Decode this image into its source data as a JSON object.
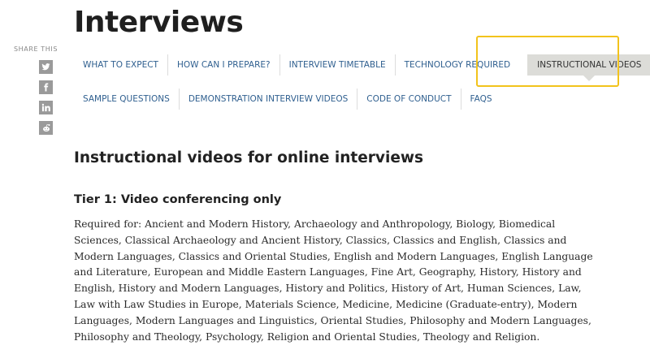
{
  "page": {
    "title": "Interviews"
  },
  "share": {
    "label": "SHARE THIS",
    "buttons": [
      {
        "icon": "twitter-icon"
      },
      {
        "icon": "facebook-icon"
      },
      {
        "icon": "linkedin-icon"
      },
      {
        "icon": "reddit-icon"
      }
    ]
  },
  "nav": {
    "row1": [
      "WHAT TO EXPECT",
      "HOW CAN I PREPARE?",
      "INTERVIEW TIMETABLE",
      "TECHNOLOGY REQUIRED",
      "INSTRUCTIONAL VIDEOS"
    ],
    "row2": [
      "SAMPLE QUESTIONS",
      "DEMONSTRATION INTERVIEW VIDEOS",
      "CODE OF CONDUCT",
      "FAQS"
    ],
    "active": "INSTRUCTIONAL VIDEOS"
  },
  "content": {
    "heading": "Instructional videos for online interviews",
    "tier1_heading": "Tier 1: Video conferencing only",
    "tier1_text": "Required for: Ancient and Modern History, Archaeology and Anthropology, Biology, Biomedical Sciences, Classical Archaeology and Ancient History, Classics, Classics and English, Classics and Modern Languages, Classics and Oriental Studies, English and Modern Languages, English Language and Literature, European and Middle Eastern Languages, Fine Art, Geography, History, History and English, History and Modern Languages, History and Politics, History of Art, Human Sciences, Law, Law with Law Studies in Europe, Materials Science, Medicine, Medicine (Graduate-entry), Modern Languages, Modern Languages and Linguistics, Oriental Studies, Philosophy and Modern Languages, Philosophy and Theology, Psychology, Religion and Oriental Studies, Theology and Religion."
  },
  "colors": {
    "link": "#2f5f8f",
    "active_tab_bg": "#dcdcd8",
    "highlight": "#f2c31c",
    "share_icon_bg": "#9a9a9a"
  }
}
